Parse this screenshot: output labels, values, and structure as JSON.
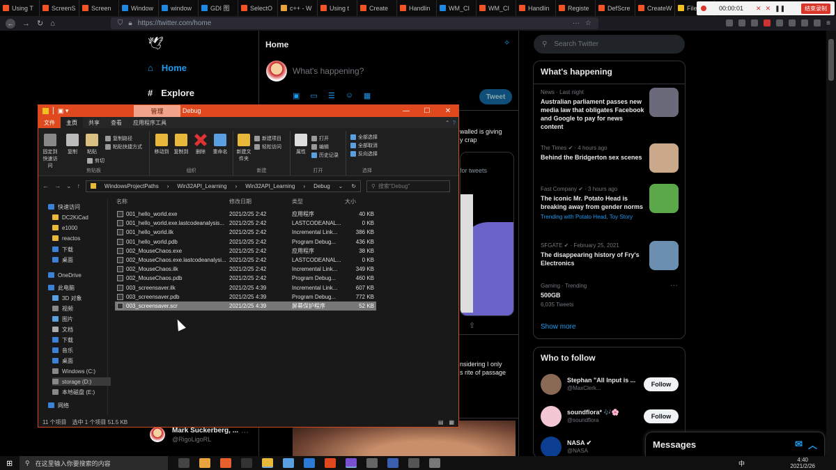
{
  "browser_tabs": [
    {
      "label": "Using T",
      "color": "#f35325"
    },
    {
      "label": "ScreenS",
      "color": "#f35325"
    },
    {
      "label": "Screen",
      "color": "#f35325"
    },
    {
      "label": "Window",
      "color": "#1e88e5"
    },
    {
      "label": "window",
      "color": "#1e88e5"
    },
    {
      "label": "GDI 图",
      "color": "#1e88e5"
    },
    {
      "label": "SelectO",
      "color": "#f35325"
    },
    {
      "label": "c++ - W",
      "color": "#e8a33d"
    },
    {
      "label": "Using t",
      "color": "#f35325"
    },
    {
      "label": "Create",
      "color": "#f35325"
    },
    {
      "label": "Handlin",
      "color": "#f35325"
    },
    {
      "label": "WM_CI",
      "color": "#1e88e5"
    },
    {
      "label": "WM_CI",
      "color": "#f35325"
    },
    {
      "label": "Handlin",
      "color": "#f35325"
    },
    {
      "label": "Registe",
      "color": "#f35325"
    },
    {
      "label": "DefScre",
      "color": "#f35325"
    },
    {
      "label": "CreateW",
      "color": "#f35325"
    },
    {
      "label": "File Do",
      "color": "#f0c020"
    }
  ],
  "recorder": {
    "time": "00:00:01",
    "stop_label": "结束录制"
  },
  "url": "https://twitter.com/home",
  "twitter": {
    "nav": [
      {
        "label": "Home"
      },
      {
        "label": "Explore"
      }
    ],
    "home_title": "Home",
    "compose_placeholder": "What's happening?",
    "tweet_button": "Tweet",
    "search_placeholder": "Search Twitter",
    "snippets": {
      "a": "walled is giving",
      "b": "y crap",
      "c": "for tweets",
      "d": "nsidering I only",
      "e": "s rite of passage"
    },
    "bottom_tweet": {
      "name": "Mark Suckerberg, ...",
      "handle": "@RigoLigoRL"
    },
    "whats_happening": {
      "title": "What's happening",
      "trends": [
        {
          "meta": "News · Last night",
          "headline": "Australian parliament passes new media law that obligates Facebook and Google to pay for news content",
          "thumb_color": "#6a6a7a"
        },
        {
          "meta": "The Times ✔ · 4 hours ago",
          "headline": "Behind the Bridgerton sex scenes",
          "thumb_color": "#c9a98a"
        },
        {
          "meta": "Fast Company ✔ · 3 hours ago",
          "headline": "The iconic Mr. Potato Head is breaking away from gender norms",
          "trending": "Trending with Potato Head, Toy Story",
          "thumb_color": "#5aa84a"
        },
        {
          "meta": "SFGATE ✔ · February 25, 2021",
          "headline": "The disappearing history of Fry's Electronics",
          "thumb_color": "#6b8fb0"
        },
        {
          "meta": "Gaming · Trending",
          "headline": "500GB",
          "sub": "6,035 Tweets"
        }
      ],
      "show_more": "Show more"
    },
    "who_to_follow": {
      "title": "Who to follow",
      "users": [
        {
          "name": "Stephan \"All Input is ...",
          "handle": "@MaxClerk...",
          "follow": "Follow",
          "color": "#8a6a55"
        },
        {
          "name": "soundflora* 🎶🌸",
          "handle": "@soundflora",
          "follow": "Follow",
          "color": "#f2c6d2"
        },
        {
          "name": "NASA ✔",
          "handle": "@NASA",
          "follow": "Follow",
          "color": "#0b3d91"
        }
      ]
    },
    "messages_label": "Messages"
  },
  "explorer": {
    "context_tab": "管理",
    "title": "Debug",
    "ribbon_tabs": [
      "文件",
      "主页",
      "共享",
      "查看",
      "应用程序工具"
    ],
    "ribbon": {
      "pin": "固定到快速访问",
      "copy": "复制",
      "paste": "粘贴",
      "cut": "剪切",
      "copy_path": "复制路径",
      "paste_shortcut": "粘贴快捷方式",
      "move_to": "移动到",
      "copy_to": "复制到",
      "delete": "删除",
      "rename": "重命名",
      "new_folder": "新建文件夹",
      "new_item": "新建项目",
      "easy_access": "轻松访问",
      "properties": "属性",
      "open": "打开",
      "edit": "编辑",
      "history": "历史记录",
      "select_all": "全部选择",
      "select_none": "全部取消",
      "invert": "反向选择",
      "groups": [
        "剪贴板",
        "组织",
        "新建",
        "打开",
        "选择"
      ]
    },
    "path": [
      "WindowsProjectPaths",
      "Win32API_Learning",
      "Win32API_Learning",
      "Debug"
    ],
    "search_placeholder": "搜索\"Debug\"",
    "nav": [
      {
        "label": "快速访问",
        "color": "#3b82d6"
      },
      {
        "label": "DC2KiCad",
        "color": "#e8b83a"
      },
      {
        "label": "e1000",
        "color": "#e8b83a"
      },
      {
        "label": "reactos",
        "color": "#e8b83a"
      },
      {
        "label": "下载",
        "color": "#3b82d6"
      },
      {
        "label": "桌面",
        "color": "#3b82d6"
      },
      {
        "label": "OneDrive",
        "color": "#3b82d6"
      },
      {
        "label": "此电脑",
        "color": "#3b82d6"
      },
      {
        "label": "3D 对象",
        "color": "#5aa0e0"
      },
      {
        "label": "视频",
        "color": "#888"
      },
      {
        "label": "图片",
        "color": "#5aa0e0"
      },
      {
        "label": "文档",
        "color": "#aaa"
      },
      {
        "label": "下载",
        "color": "#3b82d6"
      },
      {
        "label": "音乐",
        "color": "#3b82d6"
      },
      {
        "label": "桌面",
        "color": "#3b82d6"
      },
      {
        "label": "Windows (C:)",
        "color": "#888"
      },
      {
        "label": "storage (D:)",
        "color": "#888"
      },
      {
        "label": "本地磁盘 (E:)",
        "color": "#888"
      },
      {
        "label": "网络",
        "color": "#3b82d6"
      }
    ],
    "columns": [
      "名称",
      "修改日期",
      "类型",
      "大小"
    ],
    "files": [
      {
        "name": "001_hello_world.exe",
        "date": "2021/2/25 2:42",
        "type": "应用程序",
        "size": "40 KB"
      },
      {
        "name": "001_hello_world.exe.lastcodeanalysis...",
        "date": "2021/2/25 2:42",
        "type": "LASTCODEANAL...",
        "size": "0 KB"
      },
      {
        "name": "001_hello_world.ilk",
        "date": "2021/2/25 2:42",
        "type": "Incremental Link...",
        "size": "386 KB"
      },
      {
        "name": "001_hello_world.pdb",
        "date": "2021/2/25 2:42",
        "type": "Program Debug...",
        "size": "436 KB"
      },
      {
        "name": "002_MouseChaos.exe",
        "date": "2021/2/25 2:42",
        "type": "应用程序",
        "size": "38 KB"
      },
      {
        "name": "002_MouseChaos.exe.lastcodeanalysi...",
        "date": "2021/2/25 2:42",
        "type": "LASTCODEANAL...",
        "size": "0 KB"
      },
      {
        "name": "002_MouseChaos.ilk",
        "date": "2021/2/25 2:42",
        "type": "Incremental Link...",
        "size": "349 KB"
      },
      {
        "name": "002_MouseChaos.pdb",
        "date": "2021/2/25 2:42",
        "type": "Program Debug...",
        "size": "460 KB"
      },
      {
        "name": "003_screensaver.ilk",
        "date": "2021/2/25 4:39",
        "type": "Incremental Link...",
        "size": "607 KB"
      },
      {
        "name": "003_screensaver.pdb",
        "date": "2021/2/25 4:39",
        "type": "Program Debug...",
        "size": "772 KB"
      },
      {
        "name": "003_screensaver.scr",
        "date": "2021/2/25 4:39",
        "type": "屏幕保护程序",
        "size": "52 KB",
        "selected": true
      }
    ],
    "status": {
      "count": "11 个项目",
      "selected": "选中 1 个项目 51.5 KB"
    }
  },
  "taskbar": {
    "search_placeholder": "在这里输入你要搜索的内容",
    "apps": [
      {
        "name": "task-view",
        "color": "#444"
      },
      {
        "name": "search-app",
        "color": "#e8a33d"
      },
      {
        "name": "firefox",
        "color": "#e8612c"
      },
      {
        "name": "terminal",
        "color": "#333"
      },
      {
        "name": "file-explorer",
        "color": "#e8b83a"
      },
      {
        "name": "store",
        "color": "#5aa0e0"
      },
      {
        "name": "mail",
        "color": "#2a7ad6"
      },
      {
        "name": "app-orange",
        "color": "#e0481d"
      },
      {
        "name": "visual-studio",
        "color": "#7a4fd0"
      },
      {
        "name": "app-gray",
        "color": "#666"
      },
      {
        "name": "kicad",
        "color": "#3a5fb0"
      },
      {
        "name": "app-dark",
        "color": "#555"
      },
      {
        "name": "calculator",
        "color": "#777"
      }
    ],
    "time": "4:40",
    "date": "2021/2/26",
    "ime": "中"
  }
}
